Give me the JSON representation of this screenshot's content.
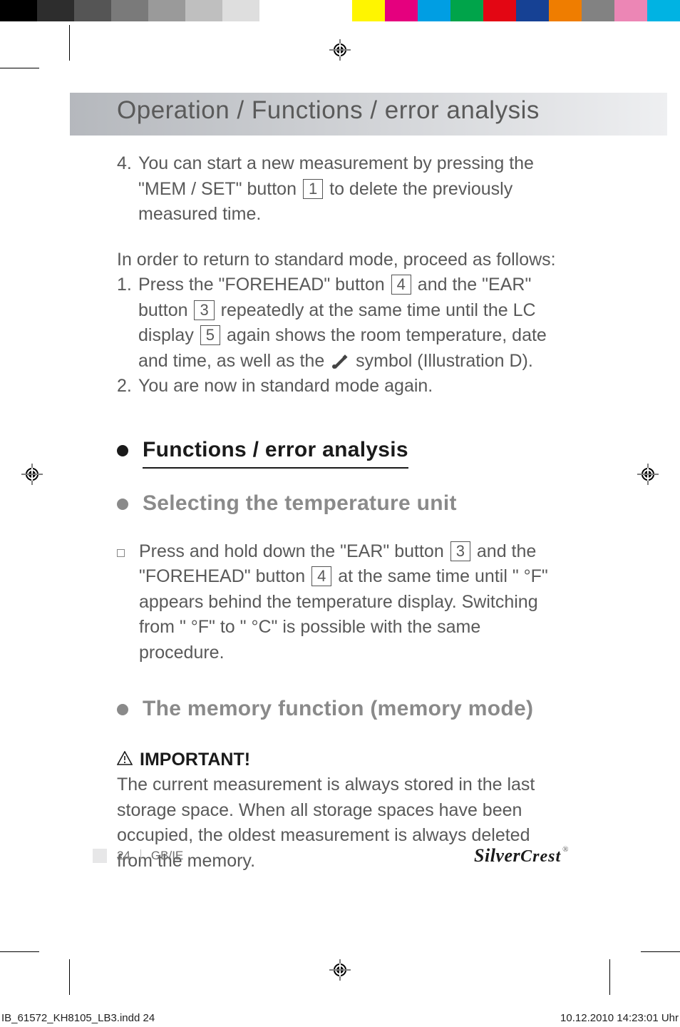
{
  "header": {
    "title": "Operation / Functions / error analysis"
  },
  "step4": {
    "num": "4.",
    "text_a": "You can start a new measurement by pressing the \"MEM / SET\" button ",
    "ref1": "1",
    "text_b": " to delete the previously measured time."
  },
  "return_intro": "In order to return to standard mode, proceed as follows:",
  "return_step1": {
    "num": "1.",
    "a": "Press the \"FOREHEAD\" button ",
    "r4": "4",
    "b": " and the \"EAR\" button ",
    "r3": "3",
    "c": " repeatedly at the same time until the LC display ",
    "r5": "5",
    "d": " again shows the room temperature, date and time, as well as the ",
    "e": " symbol (Illustration D)."
  },
  "return_step2": {
    "num": "2.",
    "text": "You are now in standard mode again."
  },
  "section_main": "Functions / error analysis",
  "section_sub1": "Selecting the temperature unit",
  "temp_unit": {
    "a": "Press and hold down the \"EAR\" button ",
    "r3": "3",
    "b": " and the \"FOREHEAD\" button ",
    "r4": "4",
    "c": " at the same time until \" °F\" appears behind the temperature display. Switching from \" °F\" to \" °C\" is possible with the same procedure."
  },
  "section_sub2": "The memory function (memory mode)",
  "important": {
    "label": "IMPORTANT!",
    "text": "The current measurement is always stored in the last storage space. When all storage spaces have been occupied, the oldest measurement is always deleted from the memory."
  },
  "footer": {
    "page_num": "24",
    "locale": "GB/IE",
    "brand_a": "Silver",
    "brand_b": "Crest"
  },
  "slug": {
    "file": "IB_61572_KH8105_LB3.indd   24",
    "datetime": "10.12.2010   14:23:01 Uhr"
  },
  "colorbar": {
    "grays": [
      "#000000",
      "#2d2d2d",
      "#555555",
      "#7a7a7a",
      "#9a9a9a",
      "#bfbfbf",
      "#dedede",
      "#ffffff"
    ],
    "hues": [
      "#ffffff",
      "#fff500",
      "#e5007e",
      "#009ee3",
      "#00a44a",
      "#e30613",
      "#164194",
      "#ef7d00",
      "#828282",
      "#ec86b5",
      "#00b3e3"
    ]
  }
}
